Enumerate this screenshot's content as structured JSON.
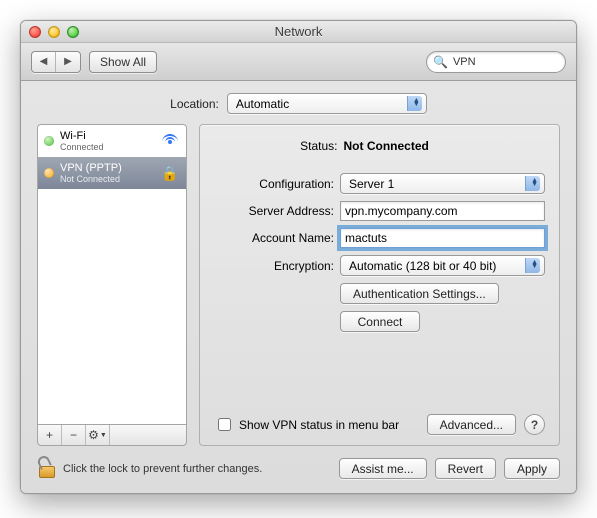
{
  "window": {
    "title": "Network"
  },
  "toolbar": {
    "show_all": "Show All",
    "search_value": "VPN"
  },
  "location": {
    "label": "Location:",
    "value": "Automatic"
  },
  "services": [
    {
      "name": "Wi-Fi",
      "status": "Connected",
      "dot": "green",
      "icon": "wifi",
      "selected": false
    },
    {
      "name": "VPN (PPTP)",
      "status": "Not Connected",
      "dot": "amber",
      "icon": "lock",
      "selected": true
    }
  ],
  "detail": {
    "status_label": "Status:",
    "status_value": "Not Connected",
    "fields": {
      "configuration_label": "Configuration:",
      "configuration_value": "Server 1",
      "server_address_label": "Server Address:",
      "server_address_value": "vpn.mycompany.com",
      "account_name_label": "Account Name:",
      "account_name_value": "mactuts",
      "encryption_label": "Encryption:",
      "encryption_value": "Automatic (128 bit or 40 bit)"
    },
    "auth_settings_btn": "Authentication Settings...",
    "connect_btn": "Connect",
    "show_status_label": "Show VPN status in menu bar",
    "advanced_btn": "Advanced...",
    "help_btn": "?"
  },
  "footer": {
    "lock_msg": "Click the lock to prevent further changes.",
    "assist_btn": "Assist me...",
    "revert_btn": "Revert",
    "apply_btn": "Apply"
  }
}
